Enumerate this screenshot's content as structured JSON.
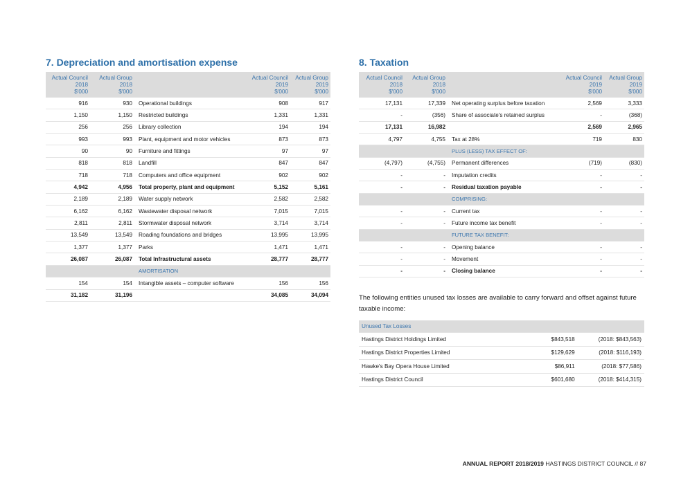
{
  "depreciation": {
    "title": "7. Depreciation and amortisation expense",
    "headers": {
      "c2018": [
        "Actual Council",
        "2018",
        "$'000"
      ],
      "g2018": [
        "Actual Group",
        "2018",
        "$'000"
      ],
      "c2019": [
        "Actual Council",
        "2019",
        "$'000"
      ],
      "g2019": [
        "Actual Group",
        "2019",
        "$'000"
      ]
    },
    "rows": [
      {
        "c18": "916",
        "g18": "930",
        "label": "Operational buildings",
        "c19": "908",
        "g19": "917"
      },
      {
        "c18": "1,150",
        "g18": "1,150",
        "label": "Restricted buildings",
        "c19": "1,331",
        "g19": "1,331"
      },
      {
        "c18": "256",
        "g18": "256",
        "label": "Library collection",
        "c19": "194",
        "g19": "194"
      },
      {
        "c18": "993",
        "g18": "993",
        "label": "Plant, equipment and motor vehicles",
        "c19": "873",
        "g19": "873"
      },
      {
        "c18": "90",
        "g18": "90",
        "label": "Furniture and fittings",
        "c19": "97",
        "g19": "97"
      },
      {
        "c18": "818",
        "g18": "818",
        "label": "Landfill",
        "c19": "847",
        "g19": "847"
      },
      {
        "c18": "718",
        "g18": "718",
        "label": "Computers and office equipment",
        "c19": "902",
        "g19": "902"
      },
      {
        "c18": "4,942",
        "g18": "4,956",
        "label": "Total property, plant and equipment",
        "c19": "5,152",
        "g19": "5,161",
        "bold": true
      },
      {
        "c18": "2,189",
        "g18": "2,189",
        "label": "Water supply network",
        "c19": "2,582",
        "g19": "2,582"
      },
      {
        "c18": "6,162",
        "g18": "6,162",
        "label": "Wastewater disposal network",
        "c19": "7,015",
        "g19": "7,015"
      },
      {
        "c18": "2,811",
        "g18": "2,811",
        "label": "Stormwater disposal network",
        "c19": "3,714",
        "g19": "3,714"
      },
      {
        "c18": "13,549",
        "g18": "13,549",
        "label": "Roading foundations and bridges",
        "c19": "13,995",
        "g19": "13,995"
      },
      {
        "c18": "1,377",
        "g18": "1,377",
        "label": "Parks",
        "c19": "1,471",
        "g19": "1,471"
      },
      {
        "c18": "26,087",
        "g18": "26,087",
        "label": "Total Infrastructural assets",
        "c19": "28,777",
        "g19": "28,777",
        "bold": true
      },
      {
        "c18": "",
        "g18": "",
        "label": "AMORTISATION",
        "c19": "",
        "g19": "",
        "sub": true
      },
      {
        "c18": "154",
        "g18": "154",
        "label": "Intangible assets – computer software",
        "c19": "156",
        "g19": "156"
      },
      {
        "c18": "31,182",
        "g18": "31,196",
        "label": "",
        "c19": "34,085",
        "g19": "34,094",
        "bold": true
      }
    ]
  },
  "taxation": {
    "title": "8. Taxation",
    "headers": {
      "c2018": [
        "Actual Council",
        "2018",
        "$'000"
      ],
      "g2018": [
        "Actual Group",
        "2018",
        "$'000"
      ],
      "c2019": [
        "Actual Council",
        "2019",
        "$'000"
      ],
      "g2019": [
        "Actual Group",
        "2019",
        "$'000"
      ]
    },
    "rows": [
      {
        "c18": "17,131",
        "g18": "17,339",
        "label": "Net operating surplus before taxation",
        "c19": "2,569",
        "g19": "3,333"
      },
      {
        "c18": "-",
        "g18": "(356)",
        "label": "Share of associate's retained surplus",
        "c19": "-",
        "g19": "(368)"
      },
      {
        "c18": "17,131",
        "g18": "16,982",
        "label": "",
        "c19": "2,569",
        "g19": "2,965",
        "bold": true
      },
      {
        "c18": "4,797",
        "g18": "4,755",
        "label": "Tax at 28%",
        "c19": "719",
        "g19": "830"
      },
      {
        "c18": "",
        "g18": "",
        "label": "PLUS (LESS) TAX EFFECT OF:",
        "c19": "",
        "g19": "",
        "sub": true
      },
      {
        "c18": "(4,797)",
        "g18": "(4,755)",
        "label": "Permanent differences",
        "c19": "(719)",
        "g19": "(830)"
      },
      {
        "c18": "-",
        "g18": "-",
        "label": "Imputation credits",
        "c19": "-",
        "g19": "-"
      },
      {
        "c18": "-",
        "g18": "-",
        "label": "Residual taxation payable",
        "c19": "-",
        "g19": "-",
        "bold": true
      },
      {
        "c18": "",
        "g18": "",
        "label": "COMPRISING:",
        "c19": "",
        "g19": "",
        "sub": true
      },
      {
        "c18": "-",
        "g18": "-",
        "label": "Current tax",
        "c19": "-",
        "g19": "-"
      },
      {
        "c18": "-",
        "g18": "-",
        "label": "Future income tax benefit",
        "c19": "-",
        "g19": "-"
      },
      {
        "c18": "",
        "g18": "",
        "label": "FUTURE TAX BENEFIT:",
        "c19": "",
        "g19": "",
        "sub": true
      },
      {
        "c18": "-",
        "g18": "-",
        "label": "Opening balance",
        "c19": "-",
        "g19": "-"
      },
      {
        "c18": "-",
        "g18": "-",
        "label": "Movement",
        "c19": "-",
        "g19": "-"
      },
      {
        "c18": "-",
        "g18": "-",
        "label": "Closing balance",
        "c19": "-",
        "g19": "-",
        "bold": true
      }
    ],
    "paragraph": "The following entities unused tax losses are available to carry forward and offset against future taxable income:",
    "losses": {
      "header": "Unused Tax Losses",
      "rows": [
        {
          "entity": "Hastings District Holdings Limited",
          "amount": "$843,518",
          "prior": "(2018: $843,563)"
        },
        {
          "entity": "Hastings District Properties Limited",
          "amount": "$129,629",
          "prior": "(2018: $116,193)"
        },
        {
          "entity": "Hawke's Bay Opera House Limited",
          "amount": "$86,911",
          "prior": "(2018:  $77,586)"
        },
        {
          "entity": "Hastings District Council",
          "amount": "$601,680",
          "prior": "(2018: $414,315)"
        }
      ]
    }
  },
  "footer": {
    "report": "ANNUAL REPORT 2018/2019",
    "org": "HASTINGS DISTRICT COUNCIL",
    "sep": "//",
    "page": "87"
  }
}
